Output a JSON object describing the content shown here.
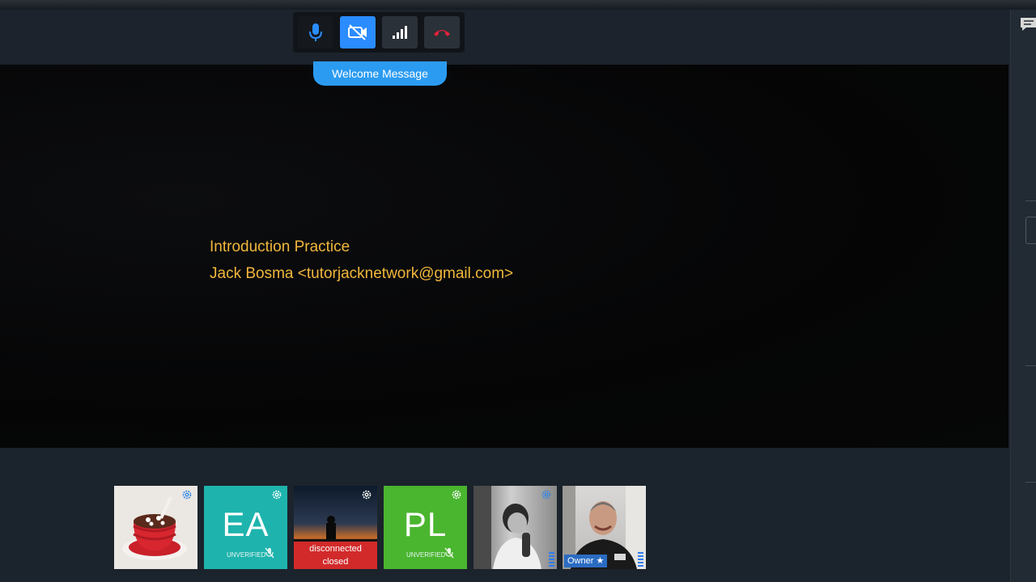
{
  "toolbar": {
    "buttons": [
      {
        "name": "microphone-button",
        "icon": "microphone-icon",
        "state": "on"
      },
      {
        "name": "camera-toggle-button",
        "icon": "video-off-icon",
        "state": "active"
      },
      {
        "name": "connection-stats-button",
        "icon": "signal-bars-icon",
        "state": "neutral"
      },
      {
        "name": "hang-up-button",
        "icon": "phone-hangup-icon",
        "state": "danger"
      }
    ]
  },
  "welcome": {
    "label": "Welcome Message"
  },
  "stage": {
    "line1": "Introduction Practice",
    "line2": "Jack Bosma <tutorjacknetwork@gmail.com>"
  },
  "colors": {
    "stage_text": "#f1b73c",
    "accent": "#2a8cff",
    "hangup": "#e0233a",
    "tile_ea": "#1eb4ad",
    "tile_pl": "#4ab52f",
    "disconnected": "#d22a2a"
  },
  "participants": [
    {
      "name": "participant-cake",
      "type": "avatar-image",
      "image": "cake-illustration"
    },
    {
      "name": "participant-ea",
      "initials": "EA",
      "badge": "UNVERIFIED",
      "muted": true
    },
    {
      "name": "participant-disconnected",
      "image": "sunset-silhouette",
      "status_line1": "disconnected",
      "status_line2": "closed"
    },
    {
      "name": "participant-pl",
      "initials": "PL",
      "badge": "UNVERIFIED",
      "muted": true
    },
    {
      "name": "participant-bw-photo",
      "image": "black-white-photo"
    },
    {
      "name": "participant-owner",
      "image": "owner-webcam",
      "badge": "Owner ★"
    }
  ]
}
